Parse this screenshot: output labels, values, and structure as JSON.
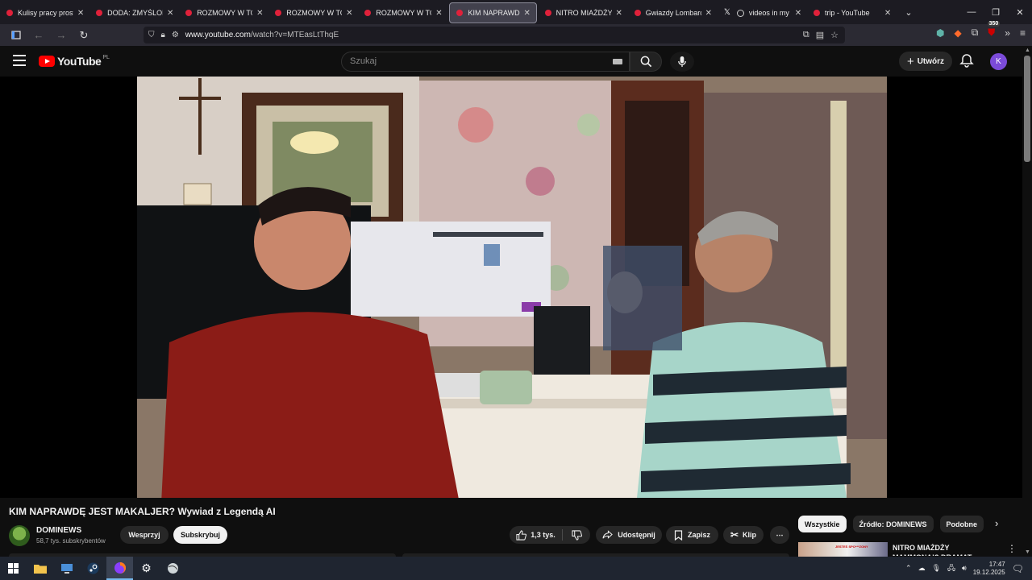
{
  "browser": {
    "tabs": [
      {
        "title": "Kulisy pracy prostytu",
        "fav": "youtube"
      },
      {
        "title": "DODA: ZMYŚLONE Z",
        "fav": "youtube"
      },
      {
        "title": "ROZMOWY W TOKU",
        "fav": "youtube"
      },
      {
        "title": "ROZMOWY W TOKU",
        "fav": "youtube"
      },
      {
        "title": "ROZMOWY W TOKU",
        "fav": "youtube"
      },
      {
        "title": "KIM NAPRAWDĘ JEST",
        "fav": "youtube",
        "active": true
      },
      {
        "title": "NITRO MIAŻDŻY MA",
        "fav": "youtube"
      },
      {
        "title": "Gwiazdy Lombardu: N",
        "fav": "youtube"
      },
      {
        "title": "videos in my fold",
        "fav": "x"
      },
      {
        "title": "trip - YouTube",
        "fav": "youtube"
      }
    ],
    "url_host": "www.youtube.com",
    "url_path": "/watch?v=MTEasLtThqE",
    "extension_badge": "350"
  },
  "youtube": {
    "logo_text": "YouTube",
    "country_code": "PL",
    "search_placeholder": "Szukaj",
    "create_label": "Utwórz",
    "avatar_letter": "K"
  },
  "video": {
    "title": "KIM NAPRAWDĘ JEST MAKALJER? Wywiad z Legendą AI",
    "channel_name": "DOMINEWS",
    "subscribers": "58,7 tys. subskrybentów",
    "support_label": "Wesprzyj",
    "subscribe_label": "Subskrybuj",
    "like_count": "1,3 tys.",
    "share_label": "Udostępnij",
    "save_label": "Zapisz",
    "clip_label": "Klip"
  },
  "sidebar": {
    "chips": [
      "Wszystkie",
      "Źródło: DOMINEWS",
      "Podobne"
    ],
    "recommendation_title": "NITRO MIAŻDŻY MAMMONA!? DRAMAT BRUCE DEBATA Z",
    "recommendation_thumb_text": "JESTEŚ SPO***ZONY"
  },
  "taskbar": {
    "time": "17:47",
    "date": "19.12.2025"
  },
  "colors": {
    "youtube_red": "#ff0000",
    "background": "#0f0f0f",
    "avatar": "#7b4bd9"
  }
}
